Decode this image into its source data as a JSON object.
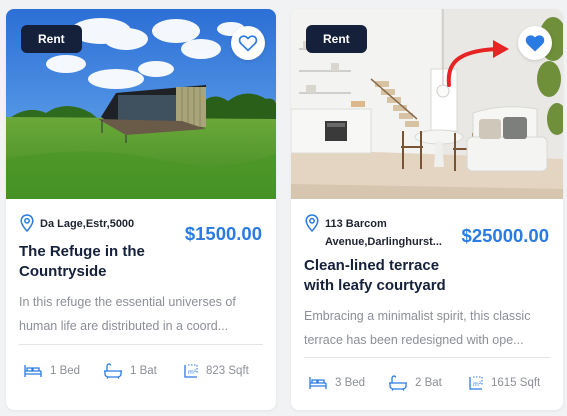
{
  "listings": [
    {
      "badge": "Rent",
      "location": "Da Lage,Estr,5000",
      "price": "$1500.00",
      "title_line1": "The Refuge in the",
      "title_line2": "Countryside",
      "desc_line1": "In this refuge the essential universes of",
      "desc_line2": "human life are distributed in a coord...",
      "beds": "1 Bed",
      "baths": "1 Bat",
      "area": "823 Sqft",
      "favorited": false
    },
    {
      "badge": "Rent",
      "location_line1": "113 Barcom",
      "location_line2": "Avenue,Darlinghurst...",
      "price": "$25000.00",
      "title_line1": "Clean-lined terrace",
      "title_line2": "with leafy courtyard",
      "desc_line1": "Embracing a minimalist spirit, this classic",
      "desc_line2": "terrace has been redesigned with ope...",
      "beds": "3 Bed",
      "baths": "2 Bat",
      "area": "1615 Sqft",
      "favorited": true
    }
  ],
  "icons": {
    "favorite": "heart-icon",
    "location": "map-pin-icon",
    "beds": "bed-icon",
    "baths": "bathtub-icon",
    "area": "area-icon",
    "annotation": "red-arrow"
  },
  "colors": {
    "accent": "#2a7be4",
    "badge": "#15203a",
    "arrow": "#e62424"
  }
}
